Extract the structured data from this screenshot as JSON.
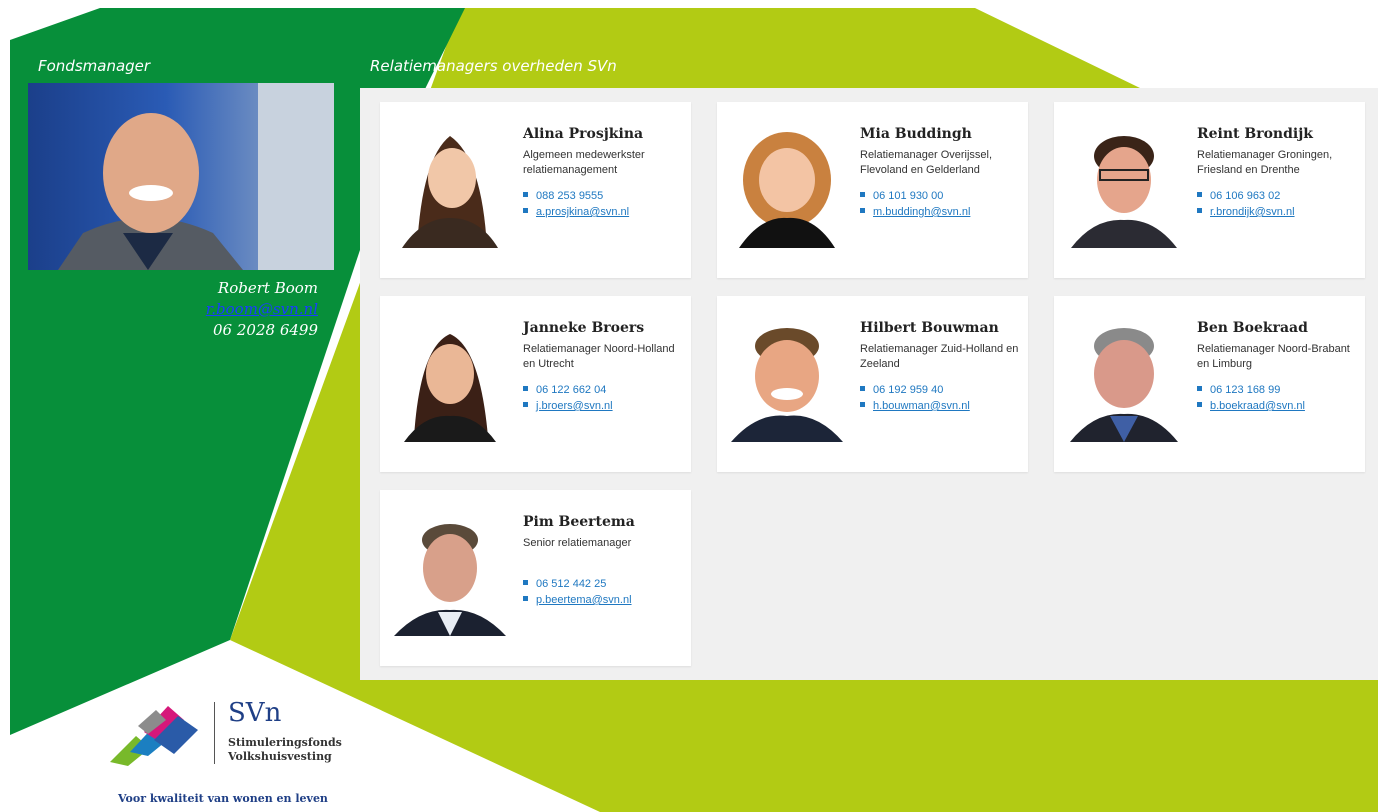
{
  "colors": {
    "dark_green": "#078f3a",
    "lime_green": "#b2cb14",
    "panel_bg": "#f0f0f0",
    "link_blue": "#1f78c1"
  },
  "fondsmanager": {
    "label": "Fondsmanager",
    "name": "Robert Boom",
    "email": "r.boom@svn.nl",
    "phone": "06 2028 6499"
  },
  "relatiemanagers": {
    "label": "Relatiemanagers overheden SVn",
    "people": [
      {
        "name": "Alina Prosjkina",
        "role": "Algemeen medewerkster relatiemanagement",
        "phone": "088 253 9555",
        "email": "a.prosjkina@svn.nl"
      },
      {
        "name": "Mia Buddingh",
        "role": "Relatiemanager Overijssel, Flevoland en Gelderland",
        "phone": "06 101 930 00",
        "email": "m.buddingh@svn.nl"
      },
      {
        "name": "Reint Brondijk",
        "role": "Relatiemanager Groningen, Friesland en Drenthe",
        "phone": "06 106 963 02",
        "email": "r.brondijk@svn.nl"
      },
      {
        "name": "Janneke Broers",
        "role": "Relatiemanager Noord-Holland en Utrecht",
        "phone": "06 122 662 04",
        "email": "j.broers@svn.nl"
      },
      {
        "name": "Hilbert Bouwman",
        "role": "Relatiemanager Zuid-Holland en Zeeland",
        "phone": "06 192 959 40",
        "email": "h.bouwman@svn.nl"
      },
      {
        "name": "Ben Boekraad",
        "role": "Relatiemanager Noord-Brabant en Limburg",
        "phone": "06 123 168 99",
        "email": "b.boekraad@svn.nl"
      },
      {
        "name": "Pim Beertema",
        "role": "Senior relatiemanager",
        "phone": "06 512 442 25",
        "email": "p.beertema@svn.nl"
      }
    ]
  },
  "logo": {
    "name": "SVn",
    "line1": "Stimuleringsfonds",
    "line2": "Volkshuisvesting",
    "tagline": "Voor kwaliteit van wonen en leven"
  }
}
